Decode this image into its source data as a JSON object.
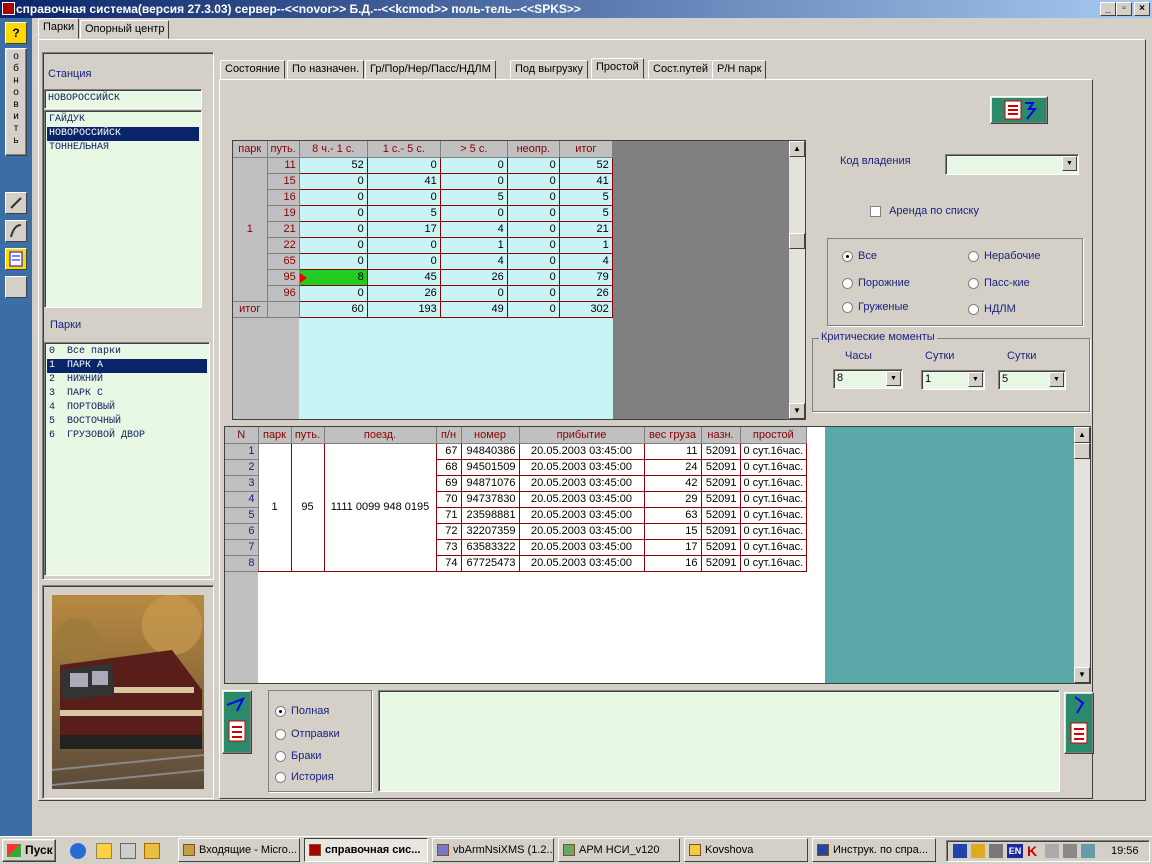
{
  "window": {
    "title": "справочная система(версия 27.3.03) сервер--<<novor>> Б.Д.--<<kcmod>> поль-тель--<<SPKS>>"
  },
  "leftbar": {
    "help": "?",
    "refresh": "обновить"
  },
  "outer_tabs": [
    {
      "label": "Парки"
    },
    {
      "label": "Опорный центр"
    }
  ],
  "station": {
    "label": "Станция",
    "value": "НОВОРОССИЙСК",
    "items": [
      "ГАЙДУК",
      "НОВОРОССИЙСК",
      "ТОННЕЛЬНАЯ"
    ]
  },
  "parks": {
    "label": "Парки",
    "items": [
      "0  Все парки",
      "1  ПАРК А",
      "2  НИЖНИЙ",
      "3  ПАРК С",
      "4  ПОРТОВЫЙ",
      "5  ВОСТОЧНЫЙ",
      "6  ГРУЗОВОЙ ДВОР"
    ]
  },
  "inner_tabs": [
    {
      "label": "Состояние"
    },
    {
      "label": "По назначен."
    },
    {
      "label": "Гр/Пор/Нер/Пасс/НДЛМ"
    },
    {
      "label": "Под выгрузку"
    },
    {
      "label": "Простой"
    },
    {
      "label": "Сост.путей"
    },
    {
      "label": "Р/Н парк"
    }
  ],
  "summary": {
    "headers": [
      "парк",
      "путь.",
      "8 ч.- 1 с.",
      "1 с.- 5 с.",
      "> 5 с.",
      "неопр.",
      "итог"
    ],
    "park": "1",
    "rows": [
      [
        "11",
        "52",
        "0",
        "0",
        "0",
        "52"
      ],
      [
        "15",
        "0",
        "41",
        "0",
        "0",
        "41"
      ],
      [
        "16",
        "0",
        "0",
        "5",
        "0",
        "5"
      ],
      [
        "19",
        "0",
        "5",
        "0",
        "0",
        "5"
      ],
      [
        "21",
        "0",
        "17",
        "4",
        "0",
        "21"
      ],
      [
        "22",
        "0",
        "0",
        "1",
        "0",
        "1"
      ],
      [
        "65",
        "0",
        "0",
        "4",
        "0",
        "4"
      ],
      [
        "95",
        "8",
        "45",
        "26",
        "0",
        "79"
      ],
      [
        "96",
        "0",
        "26",
        "0",
        "0",
        "26"
      ]
    ],
    "total_label": "итог",
    "total": [
      "60",
      "193",
      "49",
      "0",
      "302"
    ]
  },
  "owner": {
    "label": "Код владения",
    "value": ""
  },
  "lease": {
    "label": "Аренда по списку"
  },
  "filter": {
    "options": [
      "Все",
      "Нерабочие",
      "Порожние",
      "Пасс-кие",
      "Груженые",
      "НДЛМ"
    ]
  },
  "critical": {
    "title": "Критические моменты",
    "hours_label": "Часы",
    "hours": "8",
    "days1_label": "Сутки",
    "days1": "1",
    "days2_label": "Сутки",
    "days2": "5"
  },
  "detail": {
    "headers": [
      "N",
      "парк",
      "путь.",
      "поезд.",
      "п/н",
      "номер",
      "прибытие",
      "вес груза",
      "назн.",
      "простой"
    ],
    "park": "1",
    "track": "95",
    "train": "1111 0099 948 0195",
    "rows": [
      [
        "1",
        "67",
        "94840386",
        "20.05.2003  03:45:00",
        "11",
        "52091",
        "0 сут.16час."
      ],
      [
        "2",
        "68",
        "94501509",
        "20.05.2003  03:45:00",
        "24",
        "52091",
        "0 сут.16час."
      ],
      [
        "3",
        "69",
        "94871076",
        "20.05.2003  03:45:00",
        "42",
        "52091",
        "0 сут.16час."
      ],
      [
        "4",
        "70",
        "94737830",
        "20.05.2003  03:45:00",
        "29",
        "52091",
        "0 сут.16час."
      ],
      [
        "5",
        "71",
        "23598881",
        "20.05.2003  03:45:00",
        "63",
        "52091",
        "0 сут.16час."
      ],
      [
        "6",
        "72",
        "32207359",
        "20.05.2003  03:45:00",
        "15",
        "52091",
        "0 сут.16час."
      ],
      [
        "7",
        "73",
        "63583322",
        "20.05.2003  03:45:00",
        "17",
        "52091",
        "0 сут.16час."
      ],
      [
        "8",
        "74",
        "67725473",
        "20.05.2003  03:45:00",
        "16",
        "52091",
        "0 сут.16час."
      ]
    ]
  },
  "mode": {
    "options": [
      "Полная",
      "Отправки",
      "Браки",
      "История"
    ]
  },
  "taskbar": {
    "start": "Пуск",
    "tasks": [
      "Входящие - Micro...",
      "справочная сис...",
      "vbArmNsiXMS (1.2...",
      "АРМ НСИ_v120",
      "Kovshova",
      "Инструк. по спра..."
    ],
    "lang": "EN",
    "time": "19:56"
  },
  "colors": {
    "title": "#0a246a",
    "list_bg": "#e8f8e4",
    "grid_bg": "#c8f4f6",
    "teal": "#5aa8a8",
    "highlight": "#22cc22"
  }
}
